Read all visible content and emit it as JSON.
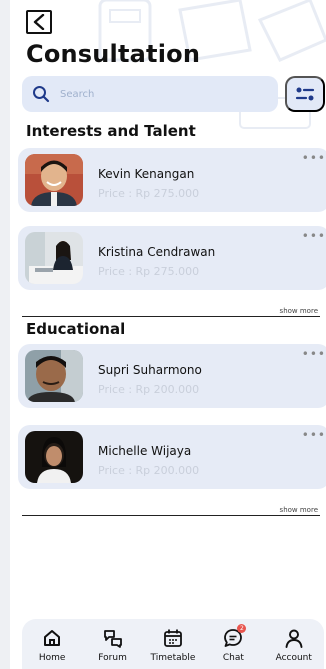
{
  "header": {
    "title": "Consultation"
  },
  "search": {
    "placeholder": "Search"
  },
  "sections": [
    {
      "title": "Interests and Talent",
      "show_more": "show more",
      "items": [
        {
          "name": "Kevin Kenangan",
          "price": "Price : Rp 275.000"
        },
        {
          "name": "Kristina Cendrawan",
          "price": "Price : Rp 275.000"
        }
      ]
    },
    {
      "title": "Educational",
      "show_more": "show more",
      "items": [
        {
          "name": "Supri Suharmono",
          "price": "Price : Rp 200.000"
        },
        {
          "name": "Michelle Wijaya",
          "price": "Price : Rp 200.000"
        }
      ]
    }
  ],
  "nav": {
    "items": [
      {
        "label": "Home",
        "icon": "home-icon"
      },
      {
        "label": "Forum",
        "icon": "forum-icon"
      },
      {
        "label": "Timetable",
        "icon": "calendar-icon"
      },
      {
        "label": "Chat",
        "icon": "chat-icon"
      },
      {
        "label": "Account",
        "icon": "user-icon"
      }
    ],
    "chat_badge": "2"
  },
  "colors": {
    "card": "#e6ebf6",
    "search": "#e2e9f7",
    "accent": "#1f3a8a",
    "badge": "#e8554e"
  }
}
